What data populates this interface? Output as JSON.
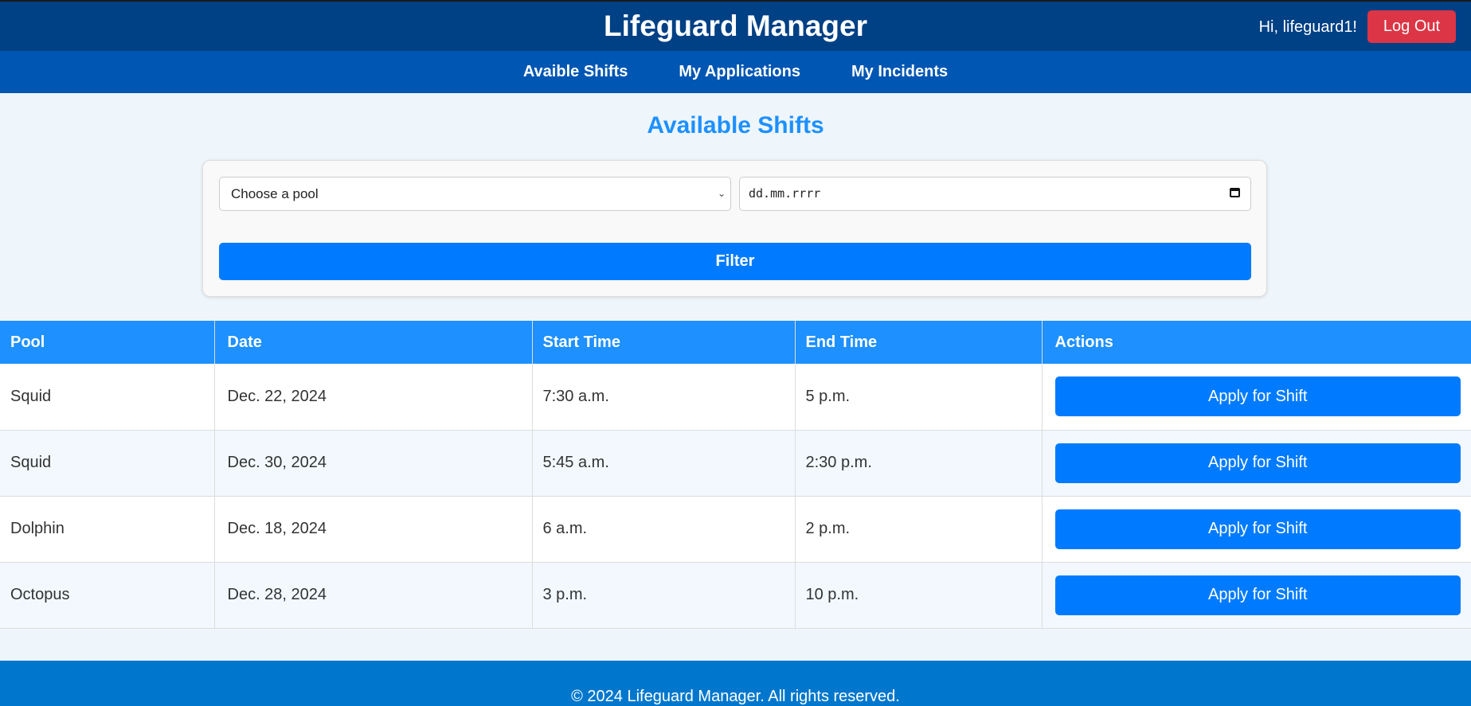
{
  "header": {
    "title": "Lifeguard Manager",
    "greeting": "Hi, lifeguard1!",
    "logout_label": "Log Out"
  },
  "nav": {
    "items": [
      {
        "label": "Avaible Shifts"
      },
      {
        "label": "My Applications"
      },
      {
        "label": "My Incidents"
      }
    ]
  },
  "main": {
    "title": "Available Shifts",
    "filter": {
      "pool_select_value": "Choose a pool",
      "date_placeholder": "dd.mm.rrrr",
      "button_label": "Filter"
    },
    "table": {
      "columns": [
        "Pool",
        "Date",
        "Start Time",
        "End Time",
        "Actions"
      ],
      "rows": [
        {
          "pool": "Squid",
          "date": "Dec. 22, 2024",
          "start": "7:30 a.m.",
          "end": "5 p.m.",
          "action": "Apply for Shift"
        },
        {
          "pool": "Squid",
          "date": "Dec. 30, 2024",
          "start": "5:45 a.m.",
          "end": "2:30 p.m.",
          "action": "Apply for Shift"
        },
        {
          "pool": "Dolphin",
          "date": "Dec. 18, 2024",
          "start": "6 a.m.",
          "end": "2 p.m.",
          "action": "Apply for Shift"
        },
        {
          "pool": "Octopus",
          "date": "Dec. 28, 2024",
          "start": "3 p.m.",
          "end": "10 p.m.",
          "action": "Apply for Shift"
        }
      ]
    }
  },
  "footer": {
    "text": "© 2024 Lifeguard Manager. All rights reserved."
  },
  "colors": {
    "header_bg": "#004085",
    "nav_bg": "#0056b3",
    "accent": "#1e90ff",
    "primary_button": "#007bff",
    "danger_button": "#dc3545",
    "footer_bg": "#0077cc"
  }
}
